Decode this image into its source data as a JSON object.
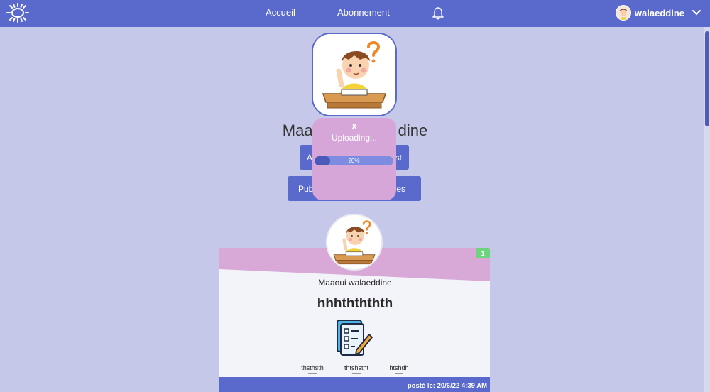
{
  "navbar": {
    "logo_icon": "sun-logo-icon",
    "links": [
      "Accueil",
      "Abonnement"
    ],
    "bell_icon": "bell-icon",
    "user_name": "walaeddine",
    "chevron_icon": "chevron-down-icon"
  },
  "profile": {
    "name_partial_left": "Maa",
    "name_partial_right": "dine",
    "button1_left": "A",
    "button1_right": "st",
    "button2_left": "Pub",
    "button2_right": "es"
  },
  "upload": {
    "close": "x",
    "status": "Uploading...",
    "progress": 0.2,
    "progress_label": "20%"
  },
  "post": {
    "badge": "1",
    "author": "Maaoui walaeddine",
    "title": "hhhthththth",
    "tags": [
      "thsthsth",
      "thtshstht",
      "htshdh"
    ],
    "date": "posté le: 20/6/22 4:39 AM"
  },
  "colors": {
    "primary": "#5a6acc",
    "background": "#c5c8e8",
    "popup": "#d7a6d8",
    "badge": "#6dd47e"
  }
}
